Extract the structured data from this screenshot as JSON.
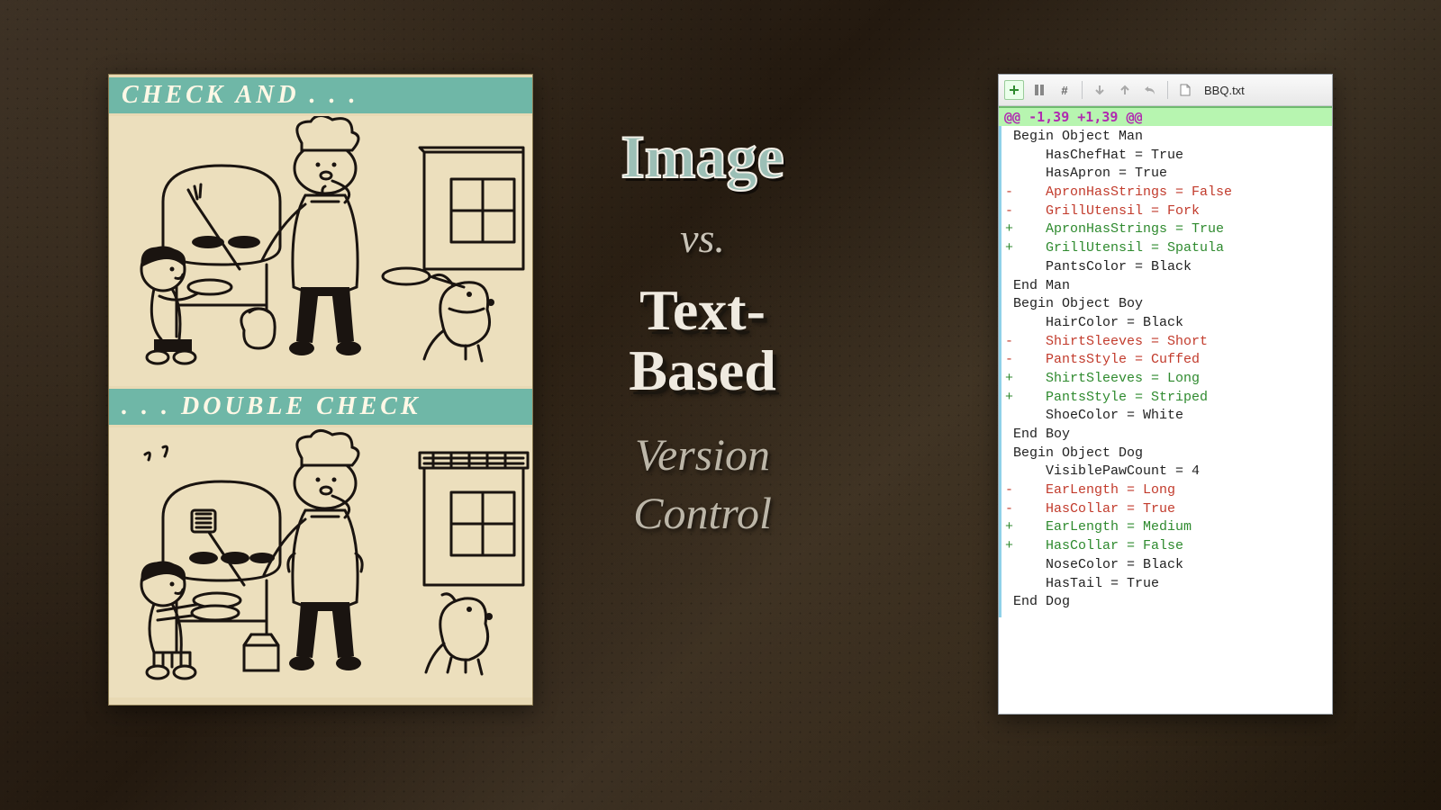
{
  "comic": {
    "top_band": "CHECK AND . . .",
    "bottom_band": ". . . DOUBLE CHECK"
  },
  "center": {
    "line1": "Image",
    "vs": "vs.",
    "line2a": "Text-",
    "line2b": "Based",
    "line3a": "Version",
    "line3b": "Control"
  },
  "diff": {
    "filename": "BBQ.txt",
    "hunk": "@@ -1,39 +1,39 @@",
    "lines": [
      {
        "t": " ",
        "s": " Begin Object Man"
      },
      {
        "t": " ",
        "s": "     HasChefHat = True"
      },
      {
        "t": " ",
        "s": "     HasApron = True"
      },
      {
        "t": "-",
        "s": "-    ApronHasStrings = False"
      },
      {
        "t": "-",
        "s": "-    GrillUtensil = Fork"
      },
      {
        "t": "+",
        "s": "+    ApronHasStrings = True"
      },
      {
        "t": "+",
        "s": "+    GrillUtensil = Spatula"
      },
      {
        "t": " ",
        "s": "     PantsColor = Black"
      },
      {
        "t": " ",
        "s": " End Man"
      },
      {
        "t": " ",
        "s": ""
      },
      {
        "t": " ",
        "s": " Begin Object Boy"
      },
      {
        "t": " ",
        "s": "     HairColor = Black"
      },
      {
        "t": "-",
        "s": "-    ShirtSleeves = Short"
      },
      {
        "t": "-",
        "s": "-    PantsStyle = Cuffed"
      },
      {
        "t": "+",
        "s": "+    ShirtSleeves = Long"
      },
      {
        "t": "+",
        "s": "+    PantsStyle = Striped"
      },
      {
        "t": " ",
        "s": "     ShoeColor = White"
      },
      {
        "t": " ",
        "s": " End Boy"
      },
      {
        "t": " ",
        "s": ""
      },
      {
        "t": " ",
        "s": " Begin Object Dog"
      },
      {
        "t": " ",
        "s": "     VisiblePawCount = 4"
      },
      {
        "t": "-",
        "s": "-    EarLength = Long"
      },
      {
        "t": "-",
        "s": "-    HasCollar = True"
      },
      {
        "t": "+",
        "s": "+    EarLength = Medium"
      },
      {
        "t": "+",
        "s": "+    HasCollar = False"
      },
      {
        "t": " ",
        "s": "     NoseColor = Black"
      },
      {
        "t": " ",
        "s": "     HasTail = True"
      },
      {
        "t": " ",
        "s": " End Dog"
      }
    ]
  }
}
